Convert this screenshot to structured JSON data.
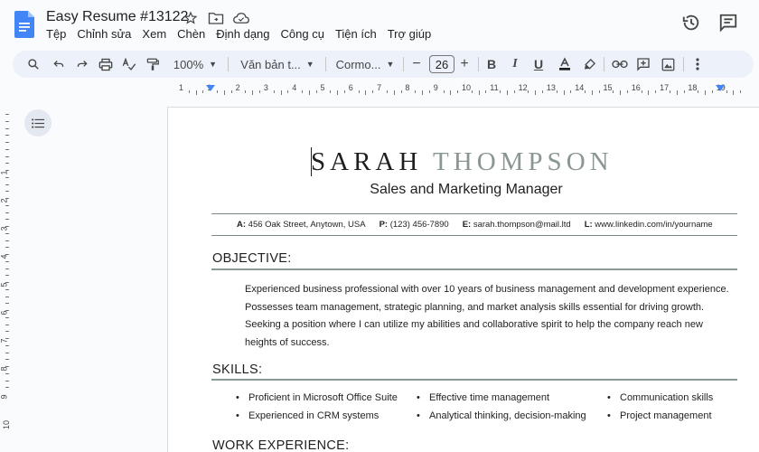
{
  "app": {
    "doc_title": "Easy Resume #13122",
    "menu": [
      "Tệp",
      "Chỉnh sửa",
      "Xem",
      "Chèn",
      "Định dạng",
      "Công cụ",
      "Tiện ích",
      "Trợ giúp"
    ]
  },
  "toolbar": {
    "zoom": "100%",
    "style": "Văn bản t...",
    "font": "Cormo...",
    "font_size": "26",
    "minus": "−",
    "plus": "+"
  },
  "ruler": {
    "numbers": [
      "1",
      "1",
      "2",
      "3",
      "4",
      "5",
      "6",
      "7",
      "8",
      "9",
      "10",
      "11",
      "12",
      "13",
      "14",
      "15",
      "16",
      "17",
      "18",
      "19"
    ],
    "vnumbers": [
      "1",
      "2",
      "3",
      "4",
      "5",
      "6",
      "7",
      "8",
      "9",
      "10"
    ]
  },
  "doc": {
    "first_name": "SARAH",
    "last_name": "THOMPSON",
    "subtitle": "Sales and Marketing Manager",
    "contact": [
      {
        "label": "A:",
        "value": "456 Oak Street, Anytown, USA"
      },
      {
        "label": "P:",
        "value": "(123) 456-7890"
      },
      {
        "label": "E:",
        "value": "sarah.thompson@mail.ltd"
      },
      {
        "label": "L:",
        "value": "www.linkedin.com/in/yourname"
      }
    ],
    "objective_heading": "OBJECTIVE:",
    "objective_lines": [
      "Experienced business professional with over 10 years of business management and development experience.",
      "Possesses team management, strategic planning, and market analysis skills essential for driving growth.",
      "Seeking a position where I can utilize my abilities and collaborative spirit to help the company reach new",
      "heights of success."
    ],
    "skills_heading": "SKILLS:",
    "skills": [
      "Proficient in Microsoft Office Suite",
      "Effective time management",
      "Communication skills",
      "Experienced in CRM systems",
      "Analytical thinking, decision-making",
      "Project management"
    ],
    "work_heading": "WORK EXPERIENCE:"
  },
  "colors": {
    "accent_grey_green": "#8a9790",
    "toolbar_bg": "#edf2fa",
    "docs_blue": "#4285f4"
  }
}
